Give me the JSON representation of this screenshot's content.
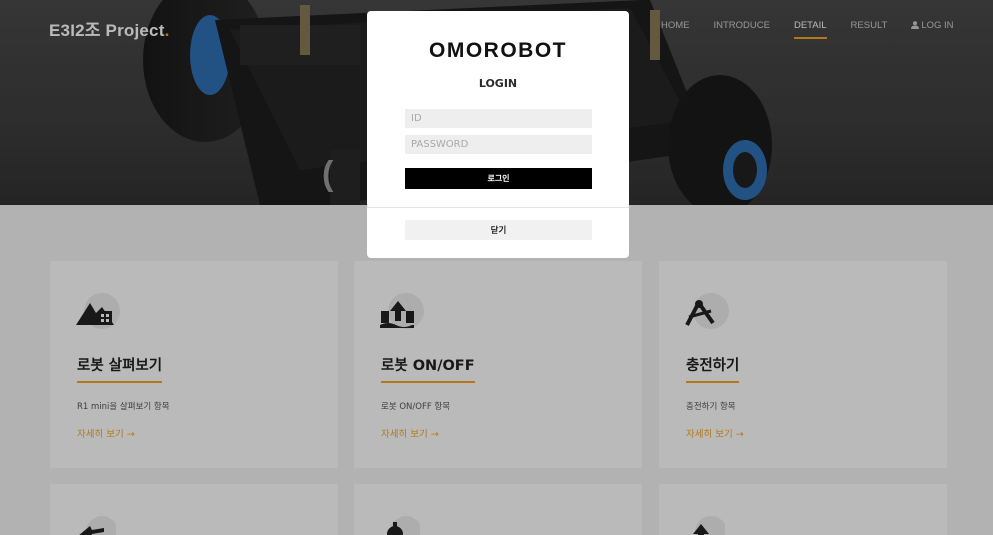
{
  "header": {
    "brand": "E3I2조 Project",
    "brand_dot": ".",
    "nav": [
      {
        "label": "HOME",
        "active": false
      },
      {
        "label": "INTRODUCE",
        "active": false
      },
      {
        "label": "DETAIL",
        "active": true
      },
      {
        "label": "RESULT",
        "active": false
      },
      {
        "label": "LOG IN",
        "active": false
      }
    ]
  },
  "cards": [
    {
      "title": "로봇 살펴보기",
      "desc": "R1 mini을 살펴보기 항목",
      "more": "자세히 보기 →",
      "icon": "mountain-icon"
    },
    {
      "title": "로봇 ON/OFF",
      "desc": "로봇 ON/OFF 항목",
      "more": "자세히 보기 →",
      "icon": "upload-icon"
    },
    {
      "title": "충전하기",
      "desc": "충전하기 항목",
      "more": "자세히 보기 →",
      "icon": "compass-icon"
    }
  ],
  "modal": {
    "logo": "OMOROBOT",
    "title": "LOGIN",
    "id_placeholder": "ID",
    "password_placeholder": "PASSWORD",
    "login_button": "로그인",
    "close_button": "닫기"
  },
  "colors": {
    "accent": "#f5a623",
    "overlay": "rgba(0,0,0,0.27)"
  }
}
